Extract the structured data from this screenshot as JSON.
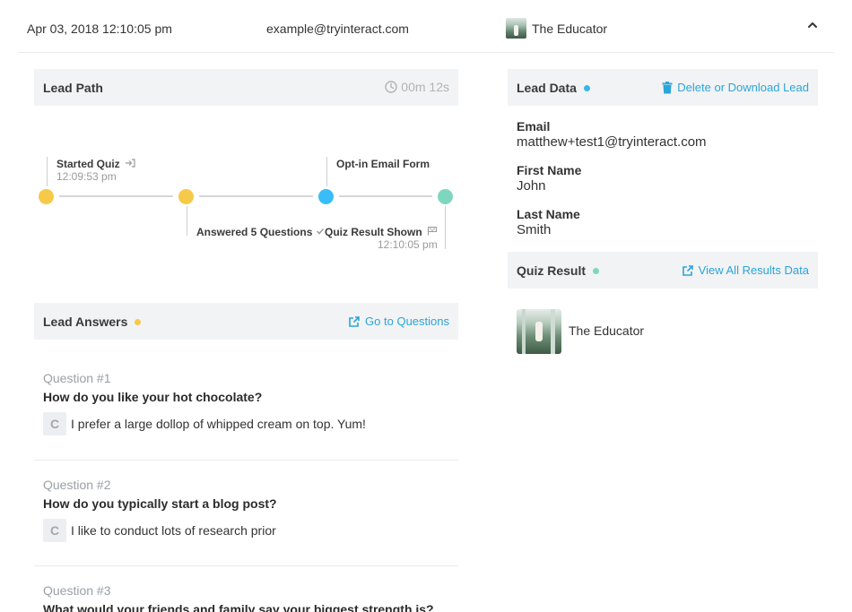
{
  "colors": {
    "accent_link": "#2aa6d8",
    "dot_yellow": "#f7c948",
    "dot_blue": "#38bdf8",
    "dot_teal": "#7fd6bf",
    "lead_data_dot": "#38b6e8",
    "quiz_result_dot": "#7fd6bf",
    "lead_answers_dot": "#f7c948"
  },
  "top": {
    "date": "Apr 03, 2018 12:10:05 pm",
    "email": "example@tryinteract.com",
    "result_name": "The Educator",
    "collapse_icon": "chevron-up-icon"
  },
  "lead_path": {
    "title": "Lead Path",
    "duration": "00m 12s",
    "steps": [
      {
        "label": "Started Quiz",
        "time": "12:09:53 pm",
        "icon": "sign-in-icon",
        "color": "#f7c948"
      },
      {
        "label": "Answered 5 Questions",
        "icon": "check-icon",
        "color": "#f7c948"
      },
      {
        "label": "Opt-in Email Form",
        "color": "#38bdf8"
      },
      {
        "label": "Quiz Result Shown",
        "time": "12:10:05 pm",
        "icon": "flag-icon",
        "color": "#7fd6bf"
      }
    ]
  },
  "lead_answers": {
    "title": "Lead Answers",
    "link": "Go to Questions",
    "questions": [
      {
        "number": "Question #1",
        "text": "How do you like your hot chocolate?",
        "choice": "C",
        "answer": "I prefer a large dollop of whipped cream on top. Yum!"
      },
      {
        "number": "Question #2",
        "text": "How do you typically start a blog post?",
        "choice": "C",
        "answer": "I like to conduct lots of research prior"
      },
      {
        "number": "Question #3",
        "text": "What would your friends and family say your biggest strength is?"
      }
    ]
  },
  "lead_data": {
    "title": "Lead Data",
    "link": "Delete or Download Lead",
    "fields": [
      {
        "label": "Email",
        "value": "matthew+test1@tryinteract.com"
      },
      {
        "label": "First Name",
        "value": "John"
      },
      {
        "label": "Last Name",
        "value": "Smith"
      }
    ]
  },
  "quiz_result": {
    "title": "Quiz Result",
    "link": "View All Results Data",
    "name": "The Educator"
  }
}
